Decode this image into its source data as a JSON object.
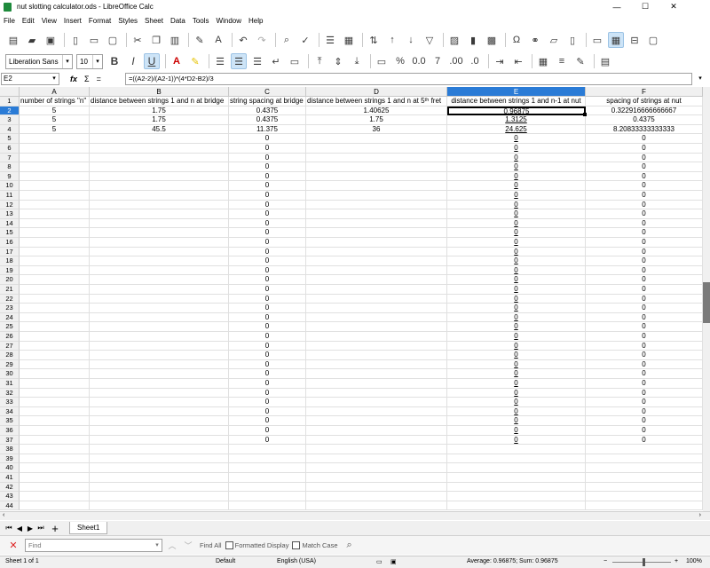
{
  "window": {
    "title": "nut slotting calculator.ods - LibreOffice Calc",
    "minimize": "—",
    "maximize": "☐",
    "close": "✕"
  },
  "menu": [
    "File",
    "Edit",
    "View",
    "Insert",
    "Format",
    "Styles",
    "Sheet",
    "Data",
    "Tools",
    "Window",
    "Help"
  ],
  "toolbar": {
    "font_name": "Liberation Sans",
    "font_size": "10"
  },
  "formula": {
    "name_box": "E2",
    "fx": "fx",
    "sum": "Σ",
    "equals": "=",
    "content": "=((A2-2)/(A2-1))*(4*D2-B2)/3"
  },
  "grid": {
    "columns": [
      "A",
      "B",
      "C",
      "D",
      "E",
      "F"
    ],
    "selected_column": "E",
    "selected_cell": "E2",
    "row_count": 44,
    "headers": [
      "number of strings \"n\"",
      "distance between strings 1 and n at bridge",
      "string spacing at bridge",
      "distance between strings 1 and n at 5ᵗʰ fret",
      "distance between strings 1 and n-1 at nut",
      "spacing of strings at nut"
    ],
    "data_rows": [
      [
        "5",
        "1.75",
        "0.4375",
        "1.40625",
        "0.96875",
        "0.322916666666667"
      ],
      [
        "5",
        "1.75",
        "0.4375",
        "1.75",
        "1.3125",
        "0.4375"
      ],
      [
        "5",
        "45.5",
        "11.375",
        "36",
        "24.625",
        "8.20833333333333"
      ]
    ],
    "zero_value": "0",
    "zero_rows_end": 37
  },
  "sheet_tabs": {
    "active": "Sheet1",
    "add": "+"
  },
  "findbar": {
    "placeholder": "Find",
    "find_all": "Find All",
    "formatted_display": "Formatted Display",
    "match_case": "Match Case"
  },
  "status": {
    "sheet": "Sheet 1 of 1",
    "page_style": "Default",
    "language": "English (USA)",
    "summary": "Average: 0.96875; Sum: 0.96875",
    "zoom": "100%"
  },
  "colors": {
    "selection_blue": "#2a7bd6",
    "header_gray": "#f0f0f0"
  }
}
